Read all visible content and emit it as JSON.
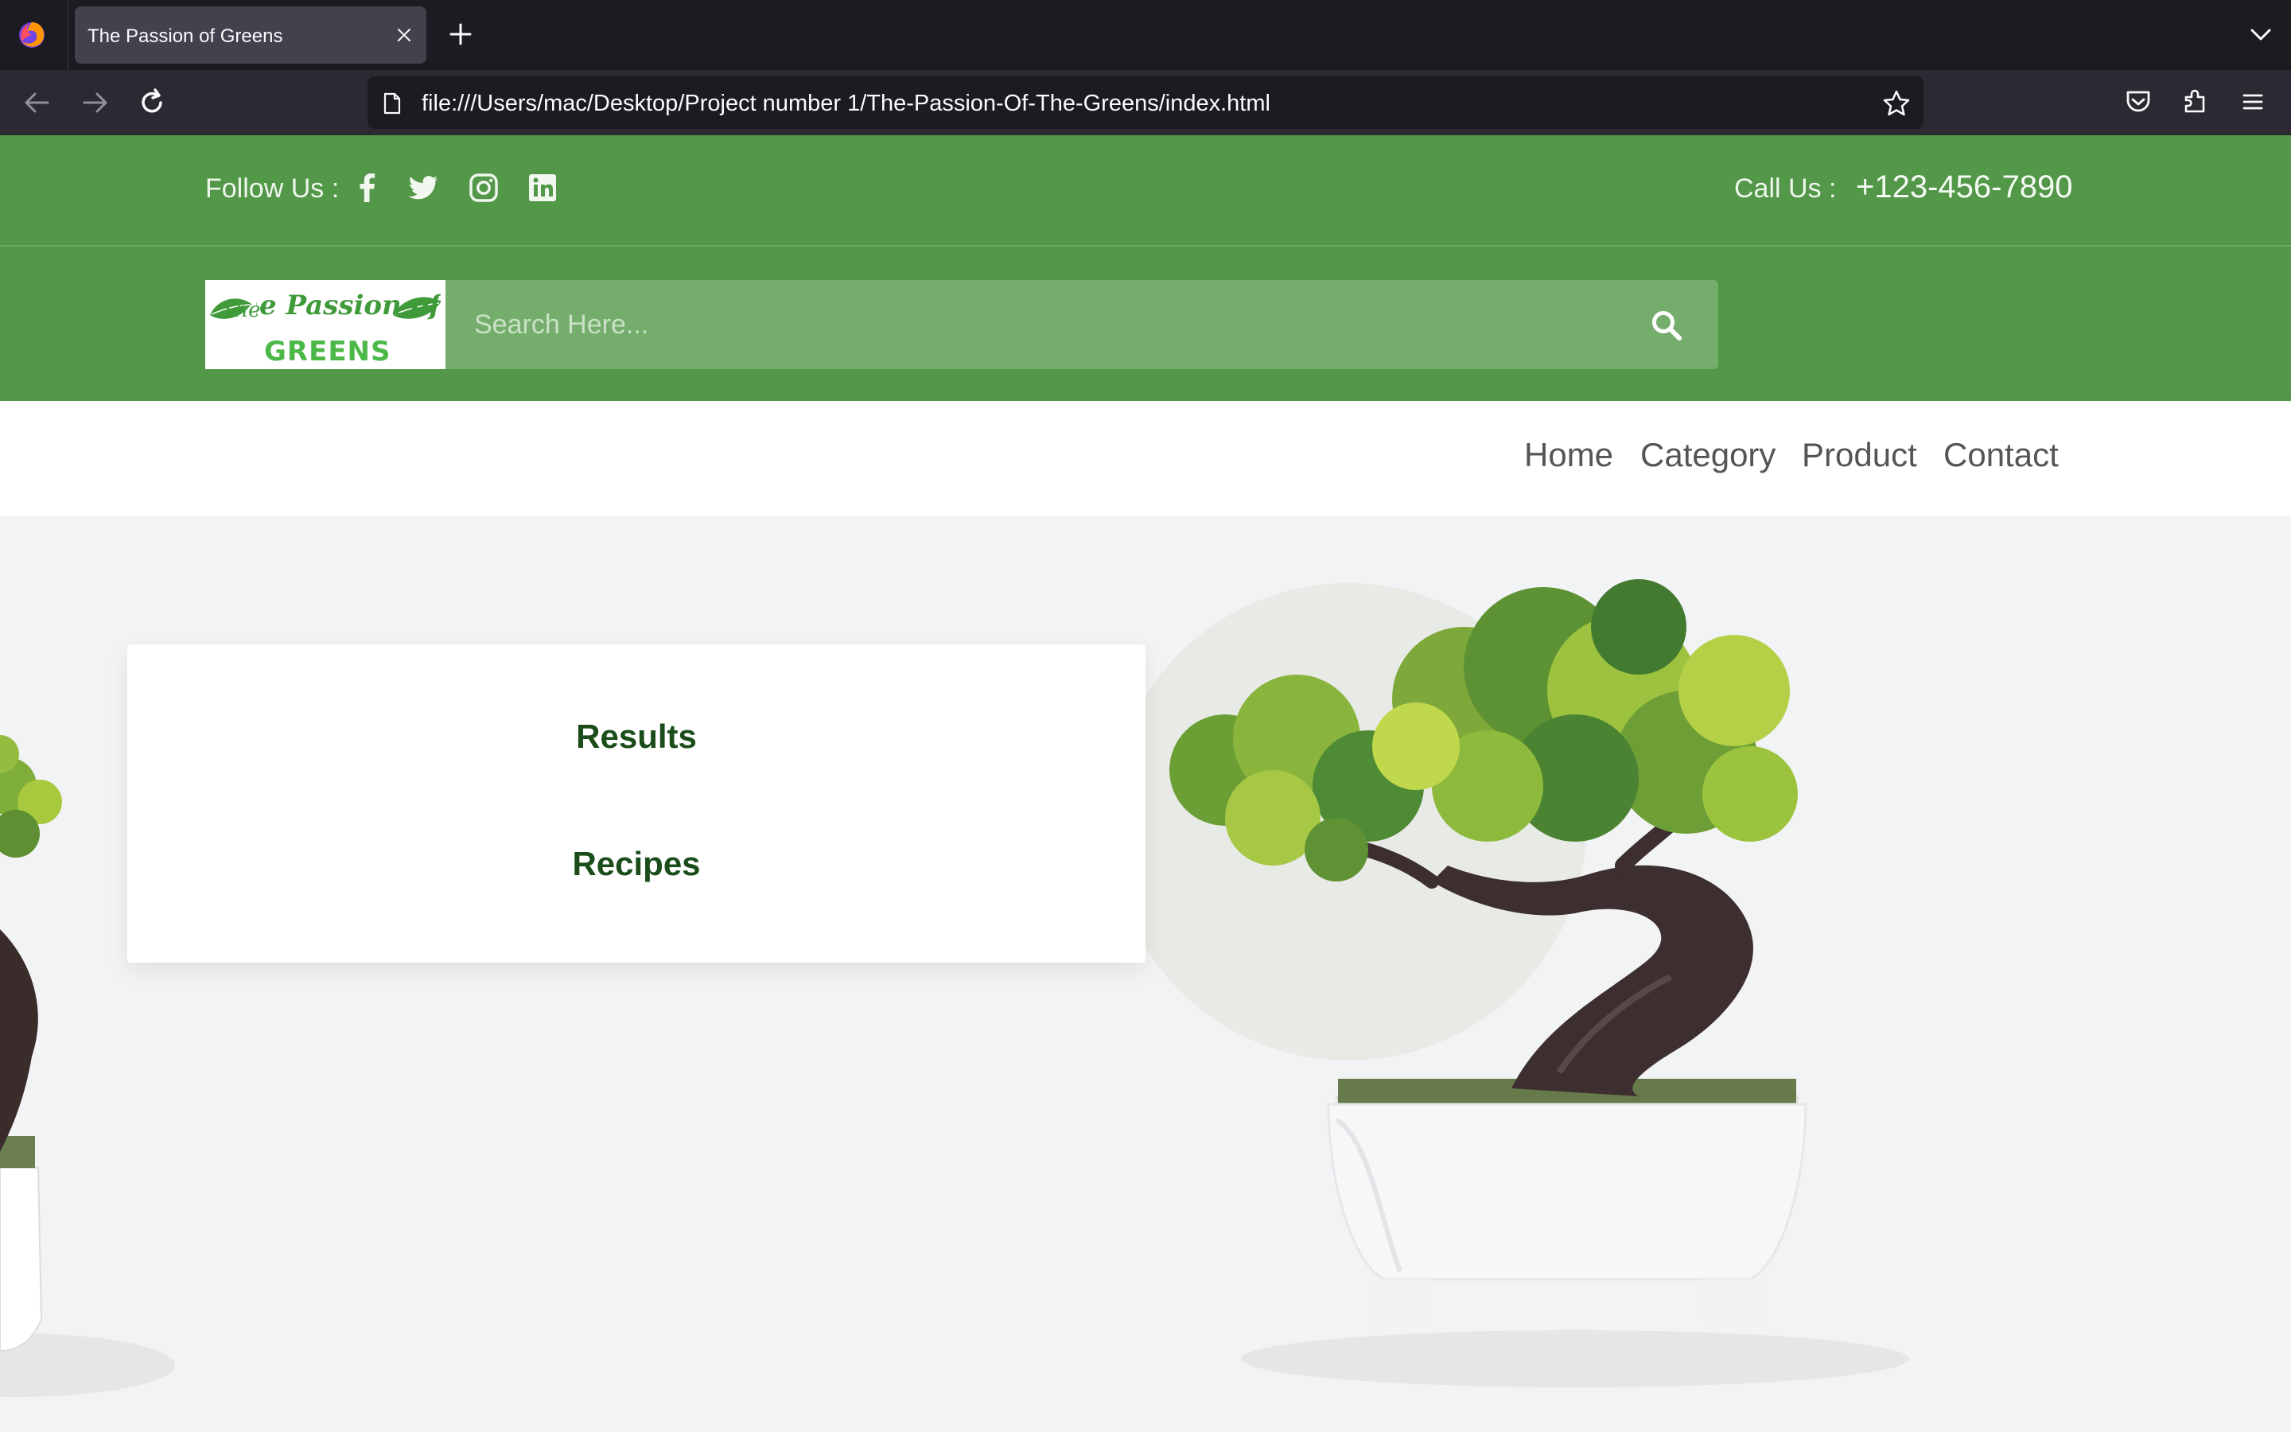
{
  "browser": {
    "tab_title": "The Passion of Greens",
    "url": "file:///Users/mac/Desktop/Project number 1/The-Passion-Of-The-Greens/index.html"
  },
  "topbar": {
    "follow_label": "Follow Us :",
    "social_icons": [
      "facebook-icon",
      "twitter-icon",
      "instagram-icon",
      "linkedin-icon"
    ],
    "call_label": "Call Us :",
    "phone": "+123-456-7890"
  },
  "brand": {
    "logo_text_top": "The Passion of",
    "logo_text_bottom": "GREENS"
  },
  "search": {
    "placeholder": "Search Here..."
  },
  "nav": {
    "items": [
      "Home",
      "Category",
      "Product",
      "Contact"
    ]
  },
  "card": {
    "links": [
      "Results",
      "Recipes"
    ]
  },
  "colors": {
    "brand_green": "#539749",
    "search_green": "#75ad6d",
    "heading_green": "#1a4d1a",
    "chrome_dark": "#1c1b22"
  }
}
